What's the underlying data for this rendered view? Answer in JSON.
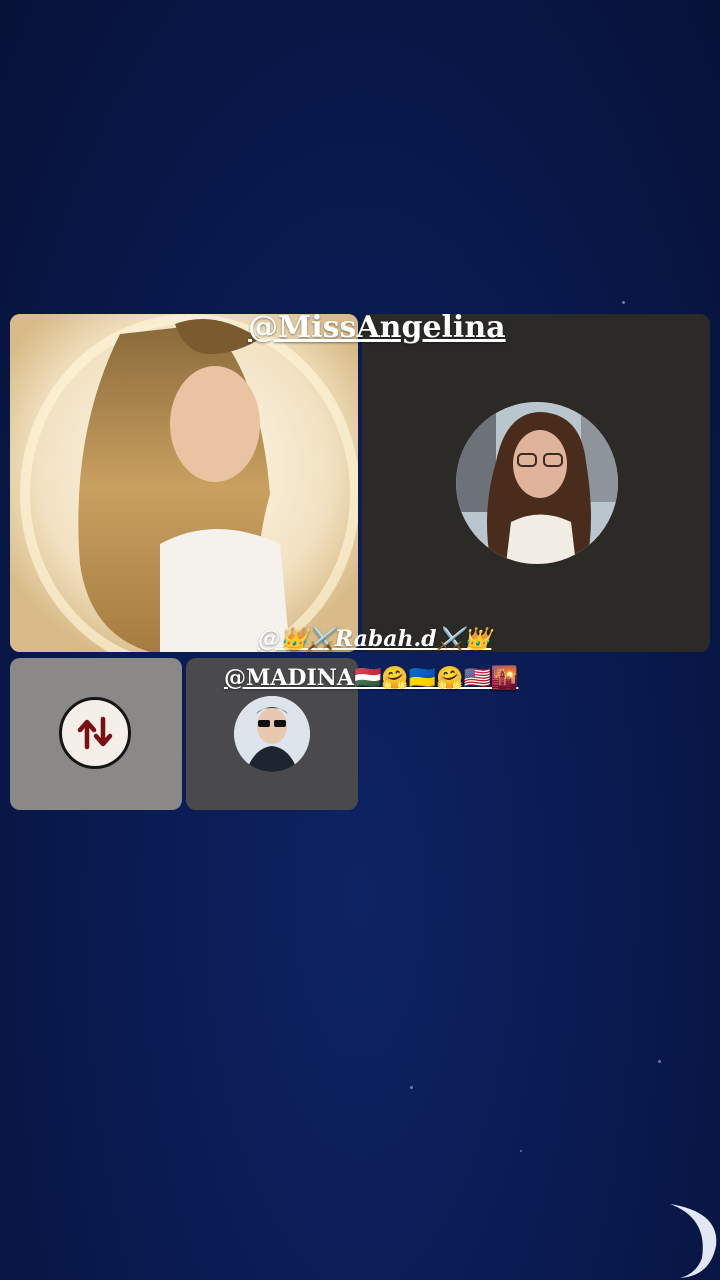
{
  "participants": {
    "main_left": {
      "handle": "@MissAngelina"
    },
    "secondary": {
      "handle": "@👑⚔️Rabah.d⚔️👑"
    },
    "tertiary": {
      "handle": "@MADINA🇭🇺🤗🇺🇦🤗🇺🇸🌇"
    }
  },
  "icons": {
    "repost": "repost-icon",
    "moon": "crescent-moon-icon"
  },
  "colors": {
    "background": "#0a1b52",
    "repost_arrows": "#7a0f12"
  }
}
